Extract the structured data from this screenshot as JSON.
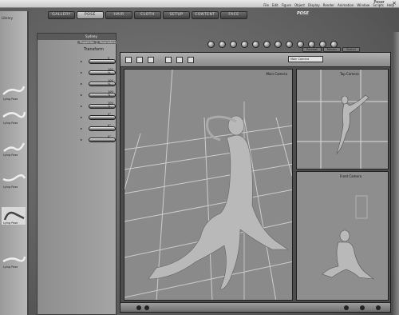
{
  "menubar": {
    "title": "Poser",
    "menus": [
      "File",
      "Edit",
      "Figure",
      "Object",
      "Display",
      "Render",
      "Animation",
      "Window",
      "Scripts",
      "Help"
    ]
  },
  "rooms": {
    "tabs": [
      "GALLERY",
      "POSE",
      "HAIR",
      "CLOTH",
      "SETUP",
      "CONTENT",
      "FACE"
    ],
    "active_label": "POSE"
  },
  "library": {
    "title": "Library",
    "items": [
      "Lying Pose",
      "Lying Pose",
      "Lying Pose",
      "Lying Pose",
      "Lying Pose",
      "Lying Pose"
    ]
  },
  "parameters": {
    "panel_label": "Sydney",
    "tabs": [
      "Properties",
      "Parameters"
    ],
    "section": "Transform",
    "dials": [
      {
        "label": "xTran",
        "value": "0"
      },
      {
        "label": "Scale",
        "value": "100 %"
      },
      {
        "label": "xScale",
        "value": "100 %"
      },
      {
        "label": "yScale",
        "value": "100 %"
      },
      {
        "label": "zScale",
        "value": "100 %"
      },
      {
        "label": "xRotate",
        "value": "0°"
      },
      {
        "label": "yRotate",
        "value": "0°"
      },
      {
        "label": "zRotate",
        "value": "0°"
      }
    ]
  },
  "document": {
    "tabs": [
      "Preview",
      "Render",
      "Sketch"
    ],
    "camera_dropdown": "Main Camera",
    "views": {
      "main": "Main Camera",
      "top_right": "Top Camera",
      "bottom_right": "Front Camera"
    }
  },
  "colors": {
    "viewport_bg": "#8a8a8a",
    "figure": "#b9b9b9",
    "grid": "#d8d8d8"
  }
}
